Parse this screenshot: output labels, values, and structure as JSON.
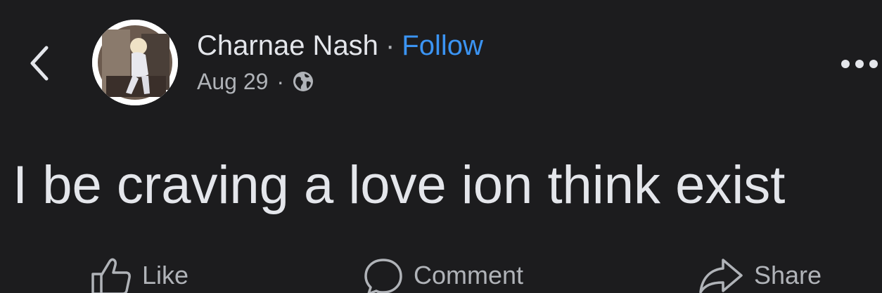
{
  "post": {
    "author": "Charnae Nash",
    "separator": "·",
    "follow_label": "Follow",
    "date": "Aug 29",
    "meta_separator": "·",
    "privacy_icon": "globe-icon",
    "text": "I be craving a love ion think exist"
  },
  "header": {
    "back_icon": "chevron-left-icon",
    "more_icon": "more-horizontal-icon"
  },
  "actions": {
    "like_label": "Like",
    "comment_label": "Comment",
    "share_label": "Share"
  },
  "colors": {
    "background": "#1c1c1e",
    "primary_text": "#e4e6eb",
    "secondary_text": "#b0b3b8",
    "link": "#3b94f3"
  }
}
